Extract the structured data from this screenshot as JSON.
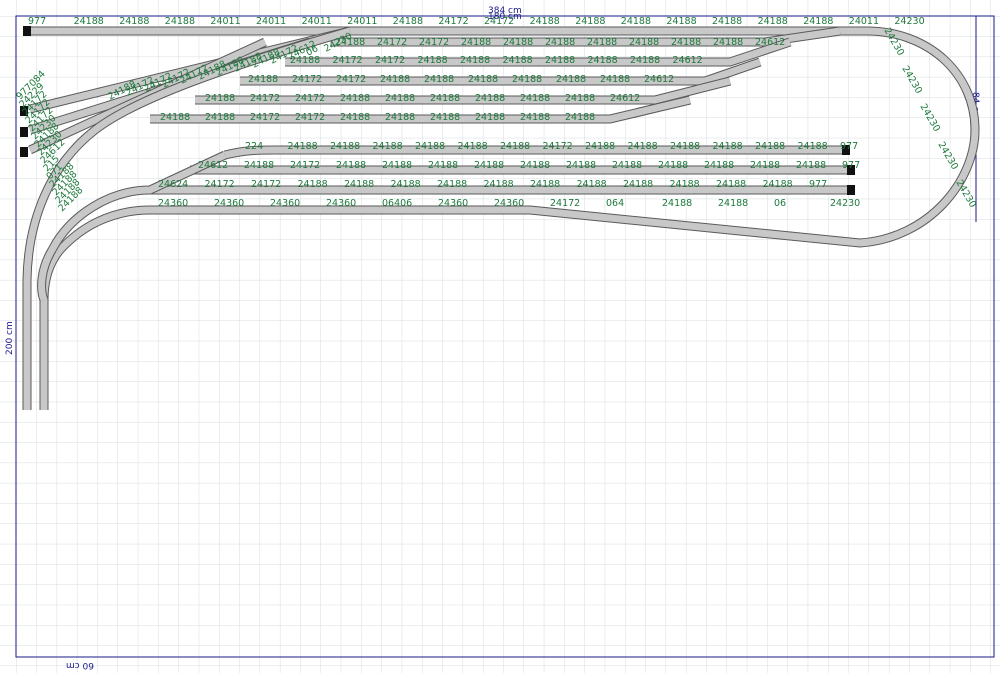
{
  "dimensions": {
    "width_label": "384 cm",
    "width_label_b": "180 cm",
    "height_label": "200 cm",
    "right_label": "84 cm",
    "bottom_label": "60 cm"
  },
  "colors": {
    "grid": "#d7dbe0",
    "border": "#1a1a8a",
    "track_rail": "#5a5a5a",
    "track_bed": "#c8c8c8",
    "label": "#1d7a3c",
    "bumper": "#111111"
  },
  "track_labels": {
    "row0": [
      "977",
      "24188",
      "24188",
      "24188",
      "24011",
      "24011",
      "24011",
      "24011",
      "24188",
      "24172",
      "24172",
      "24188",
      "24188",
      "24188",
      "24188",
      "24188",
      "24188",
      "24188",
      "24011",
      "24230"
    ],
    "row1": [
      "24188",
      "24172",
      "24172",
      "24188",
      "24188",
      "24188",
      "24188",
      "24188",
      "24188",
      "24188",
      "24612"
    ],
    "row2": [
      "24188",
      "24172",
      "24172",
      "24188",
      "24188",
      "24188",
      "24188",
      "24188",
      "24188",
      "24612"
    ],
    "row3": [
      "24188",
      "24172",
      "24172",
      "24188",
      "24188",
      "24188",
      "24188",
      "24188",
      "24188",
      "24612"
    ],
    "row4": [
      "24188",
      "24172",
      "24172",
      "24188",
      "24188",
      "24188",
      "24188",
      "24188",
      "24188",
      "24612"
    ],
    "row5": [
      "24188",
      "24188",
      "24172",
      "24172",
      "24188",
      "24188",
      "24188",
      "24188",
      "24188",
      "24188"
    ],
    "row6": [
      "224",
      "24188",
      "24188",
      "24188",
      "24188",
      "24188",
      "24188",
      "24172",
      "24188",
      "24188",
      "24188",
      "24188",
      "24188",
      "24188",
      "977"
    ],
    "row7": [
      "24612",
      "24188",
      "24172",
      "24188",
      "24188",
      "24188",
      "24188",
      "24188",
      "24188",
      "24188",
      "24188",
      "24188",
      "24188",
      "24188",
      "977"
    ],
    "row8": [
      "24624",
      "24172",
      "24172",
      "24188",
      "24188",
      "24188",
      "24188",
      "24188",
      "24188",
      "24188",
      "24188",
      "24188",
      "24188",
      "24188",
      "977"
    ],
    "row9": [
      "24360",
      "24360",
      "24360",
      "24360",
      "06406",
      "24360",
      "24360",
      "24172",
      "064",
      "24188",
      "24188",
      "06",
      "24230"
    ],
    "left": [
      "977084",
      "24229",
      "24172",
      "24172",
      "24172",
      "24230",
      "24188",
      "24230",
      "24612",
      "215",
      "071",
      "24188",
      "24188",
      "24188",
      "24188"
    ],
    "ladder": [
      "24188",
      "24172",
      "24172",
      "24172",
      "24172",
      "24188",
      "24188",
      "24188",
      "24188",
      "24172",
      "24612",
      "06",
      "24230"
    ],
    "right_curve": [
      "24230",
      "24230",
      "24230",
      "24230",
      "24230"
    ]
  }
}
